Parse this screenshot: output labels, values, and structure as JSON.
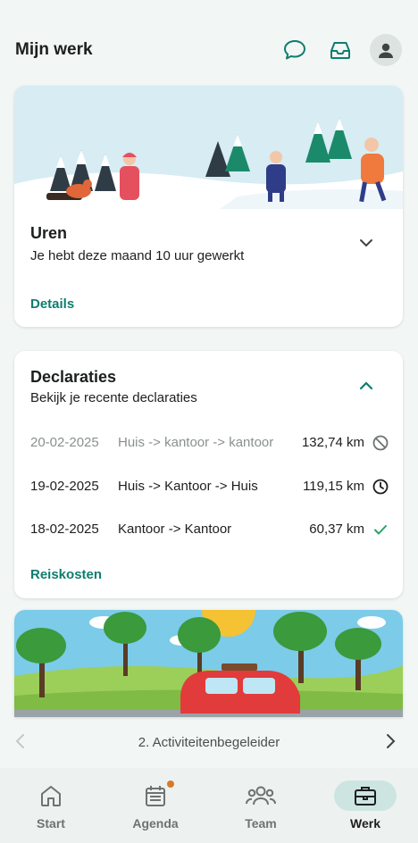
{
  "header": {
    "title": "Mijn werk"
  },
  "uren_card": {
    "title": "Uren",
    "subtitle": "Je hebt deze maand 10 uur gewerkt",
    "link": "Details"
  },
  "declaraties_card": {
    "title": "Declaraties",
    "subtitle": "Bekijk je recente declaraties",
    "rows": [
      {
        "date": "20-02-2025",
        "route": "Huis -> kantoor -> kantoor",
        "km": "132,74 km",
        "status": "rejected-icon"
      },
      {
        "date": "19-02-2025",
        "route": "Huis -> Kantoor -> Huis",
        "km": "119,15 km",
        "status": "pending-icon"
      },
      {
        "date": "18-02-2025",
        "route": "Kantoor -> Kantoor",
        "km": "60,37 km",
        "status": "approved-icon"
      }
    ],
    "link": "Reiskosten"
  },
  "carousel": {
    "label": "2. Activiteitenbegeleider"
  },
  "nav": {
    "items": [
      {
        "label": "Start",
        "icon": "home-icon"
      },
      {
        "label": "Agenda",
        "icon": "calendar-icon"
      },
      {
        "label": "Team",
        "icon": "team-icon"
      },
      {
        "label": "Werk",
        "icon": "briefcase-icon"
      }
    ]
  },
  "colors": {
    "accent": "#0f7d6e",
    "nav_active": "#cde5e1",
    "badge": "#d67a2a"
  }
}
